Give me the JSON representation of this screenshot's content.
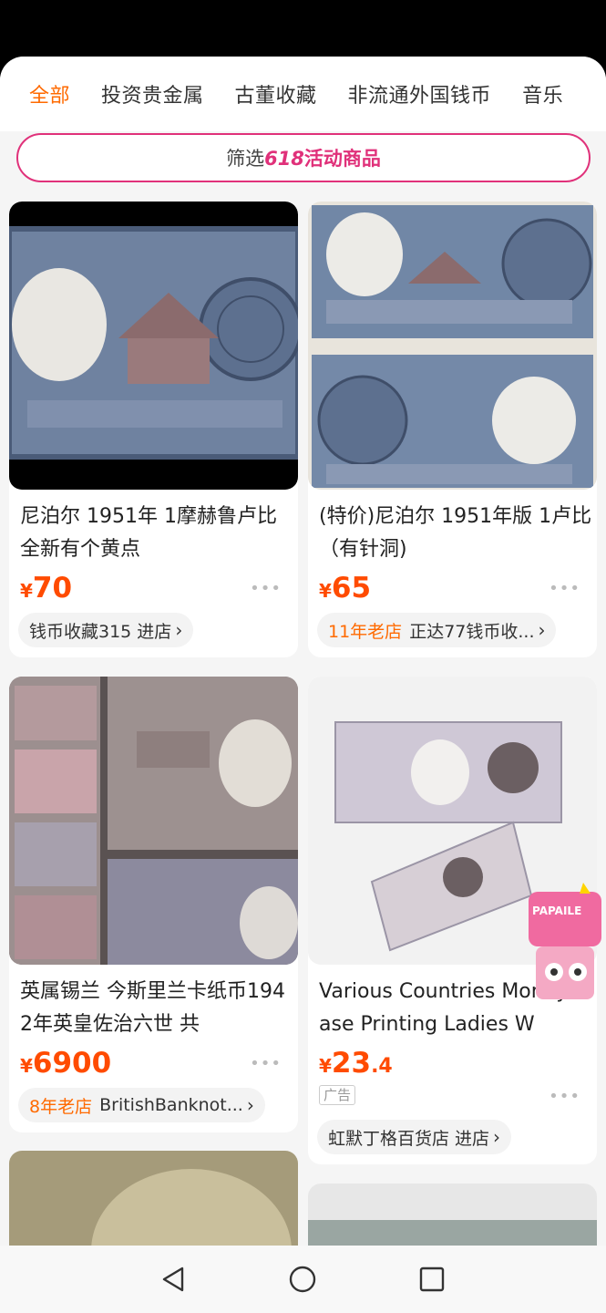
{
  "tabs": [
    "全部",
    "投资贵金属",
    "古董收藏",
    "非流通外国钱币",
    "音乐"
  ],
  "filter": {
    "prefix": "筛选",
    "event": "618",
    "suffix": "活动商品"
  },
  "products": [
    {
      "title": "尼泊尔 1951年 1摩赫鲁卢比 全新有个黄点",
      "currency": "¥",
      "price": "70",
      "price_dec": "",
      "shop_age": "",
      "shop": "钱币收藏315 进店",
      "ad": ""
    },
    {
      "title": "(特价)尼泊尔 1951年版 1卢比 （有针洞)",
      "currency": "¥",
      "price": "65",
      "price_dec": "",
      "shop_age": "11年老店",
      "shop": "正达77钱币收...",
      "ad": ""
    },
    {
      "title": "英属锡兰 今斯里兰卡纸币1942年英皇佐治六世 共",
      "currency": "¥",
      "price": "6900",
      "price_dec": "",
      "shop_age": "8年老店",
      "shop": "BritishBanknot...",
      "ad": ""
    },
    {
      "title": "Various Countries Money Case Printing Ladies W",
      "currency": "¥",
      "price": "23",
      "price_dec": ".4",
      "shop_age": "",
      "shop": "虹默丁格百货店 进店",
      "ad": "广告"
    }
  ],
  "more_glyph": "•••",
  "chevron_glyph": "›",
  "mascot_text": "PAPAILE",
  "colors": {
    "accent": "#ff6a00",
    "price": "#ff4b00",
    "event": "#e0317a"
  },
  "icons": [
    "back-triangle-icon",
    "home-circle-icon",
    "recents-square-icon",
    "chevron-right-icon",
    "more-dots-icon"
  ]
}
